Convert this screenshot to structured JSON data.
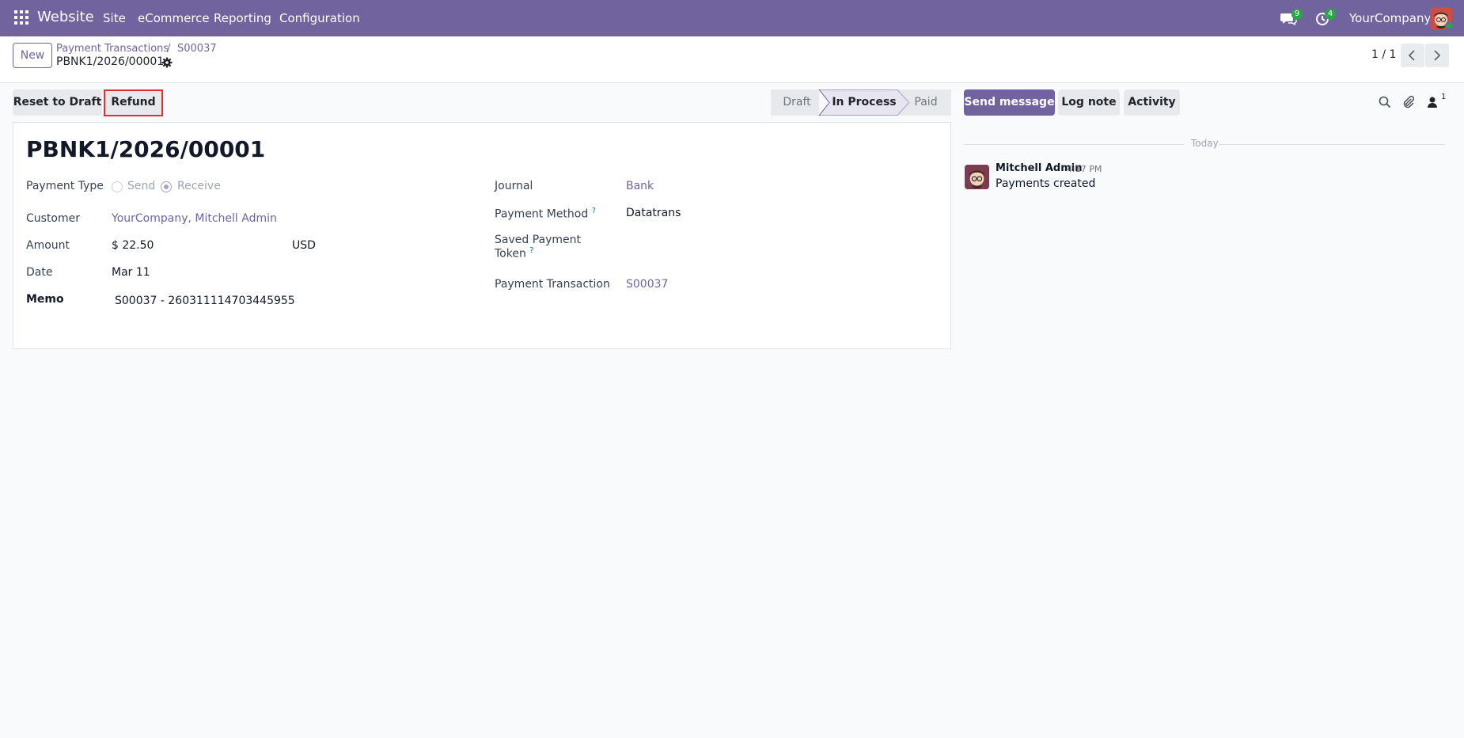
{
  "navbar": {
    "app_name": "Website",
    "menu": [
      "Site",
      "eCommerce",
      "Reporting",
      "Configuration"
    ],
    "messages_count": "9",
    "activities_count": "4",
    "company": "YourCompany"
  },
  "control_panel": {
    "new_label": "New",
    "breadcrumb": [
      "Payment Transactions",
      "S00037"
    ],
    "record_title": "PBNK1/2026/00001",
    "pager": "1 / 1"
  },
  "actions": {
    "reset_to_draft": "Reset to Draft",
    "refund": "Refund"
  },
  "statusbar": {
    "stages": [
      "Draft",
      "In Process",
      "Paid"
    ],
    "current": "In Process"
  },
  "form": {
    "name": "PBNK1/2026/00001",
    "payment_type_label": "Payment Type",
    "payment_type_options": [
      "Send",
      "Receive"
    ],
    "payment_type_selected": "Receive",
    "customer_label": "Customer",
    "customer_value": "YourCompany, Mitchell Admin",
    "amount_label": "Amount",
    "amount_value": "$ 22.50",
    "currency": "USD",
    "date_label": "Date",
    "date_value": "Mar 11",
    "memo_label": "Memo",
    "memo_value": "S00037 - 260311114703445955",
    "journal_label": "Journal",
    "journal_value": "Bank",
    "payment_method_label": "Payment Method",
    "payment_method_value": "Datatrans",
    "saved_token_label_line1": "Saved Payment",
    "saved_token_label_line2": "Token",
    "help_mark": "?",
    "payment_transaction_label": "Payment Transaction",
    "payment_transaction_value": "S00037"
  },
  "chatter": {
    "send_message": "Send message",
    "log_note": "Log note",
    "activity": "Activity",
    "followers_count": "1",
    "date_separator": "Today",
    "message": {
      "author": "Mitchell Admin",
      "time": "4:17 PM",
      "body": "Payments created"
    }
  },
  "colors": {
    "brand": "#71639e",
    "badge": "#28a745",
    "highlight": "#e62e2e"
  }
}
